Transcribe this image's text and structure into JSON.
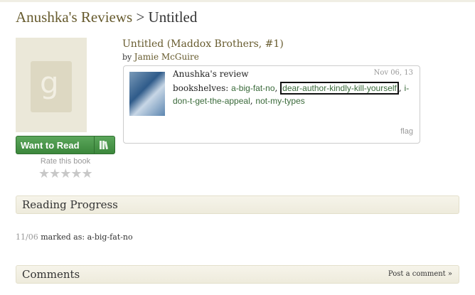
{
  "header": {
    "crumb": "Anushka's Reviews",
    "sep": ">",
    "page": "Untitled"
  },
  "book": {
    "title": "Untitled (Maddox Brothers, #1)",
    "by_label": "by",
    "author": "Jamie McGuire",
    "cover_letter": "g"
  },
  "actions": {
    "want_to_read": "Want to Read",
    "rate_label": "Rate this book",
    "stars": "★★★★★",
    "star_count": 5,
    "rating": 0
  },
  "review": {
    "reviewer": "Anushka's review",
    "date": "Nov 06, 13",
    "shelves_label": "bookshelves:",
    "shelf_1": "a-big-fat-no",
    "shelf_2": "dear-author-kindly-kill-yourself",
    "shelf_3": "i-don-t-get-the-appeal",
    "shelf_4": "not-my-types",
    "flag": "flag"
  },
  "progress": {
    "heading": "Reading Progress",
    "date": "11/06",
    "text": "marked as: a-big-fat-no"
  },
  "comments": {
    "heading": "Comments",
    "post": "Post a comment »"
  }
}
